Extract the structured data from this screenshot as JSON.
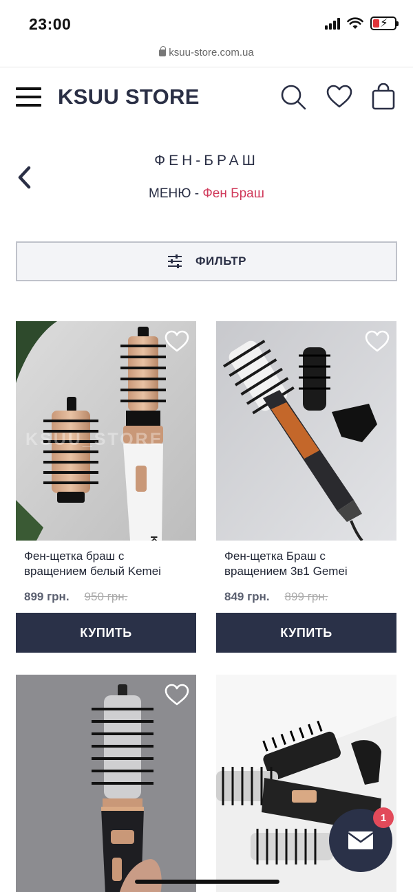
{
  "status": {
    "time": "23:00"
  },
  "browser": {
    "url": "ksuu-store.com.ua"
  },
  "header": {
    "logo": "KSUU STORE",
    "icons": [
      "menu-icon",
      "search-icon",
      "heart-icon",
      "shopping-bag-icon"
    ]
  },
  "page": {
    "title": "ФЕН-БРАШ",
    "breadcrumb_root": "МЕНЮ",
    "breadcrumb_sep": "-",
    "breadcrumb_current": "Фен Браш"
  },
  "filter": {
    "label": "ФИЛЬТР"
  },
  "products": [
    {
      "title": "Фен-щетка браш с вращением белый Kemei",
      "price": "899 грн.",
      "old_price": "950 грн.",
      "buy_label": "КУПИТЬ",
      "watermark": "KSUU_STORE"
    },
    {
      "title": "Фен-щетка Браш с вращением 3в1 Gemei",
      "price": "849 грн.",
      "old_price": "899 грн.",
      "buy_label": "КУПИТЬ"
    },
    {
      "title": "",
      "price": "",
      "old_price": "",
      "buy_label": ""
    },
    {
      "title": "",
      "price": "",
      "old_price": "",
      "buy_label": ""
    }
  ],
  "chat": {
    "badge_count": "1"
  },
  "colors": {
    "brand_dark": "#2a3148",
    "accent_pink": "#d0395a",
    "badge_red": "#e24a5a"
  }
}
